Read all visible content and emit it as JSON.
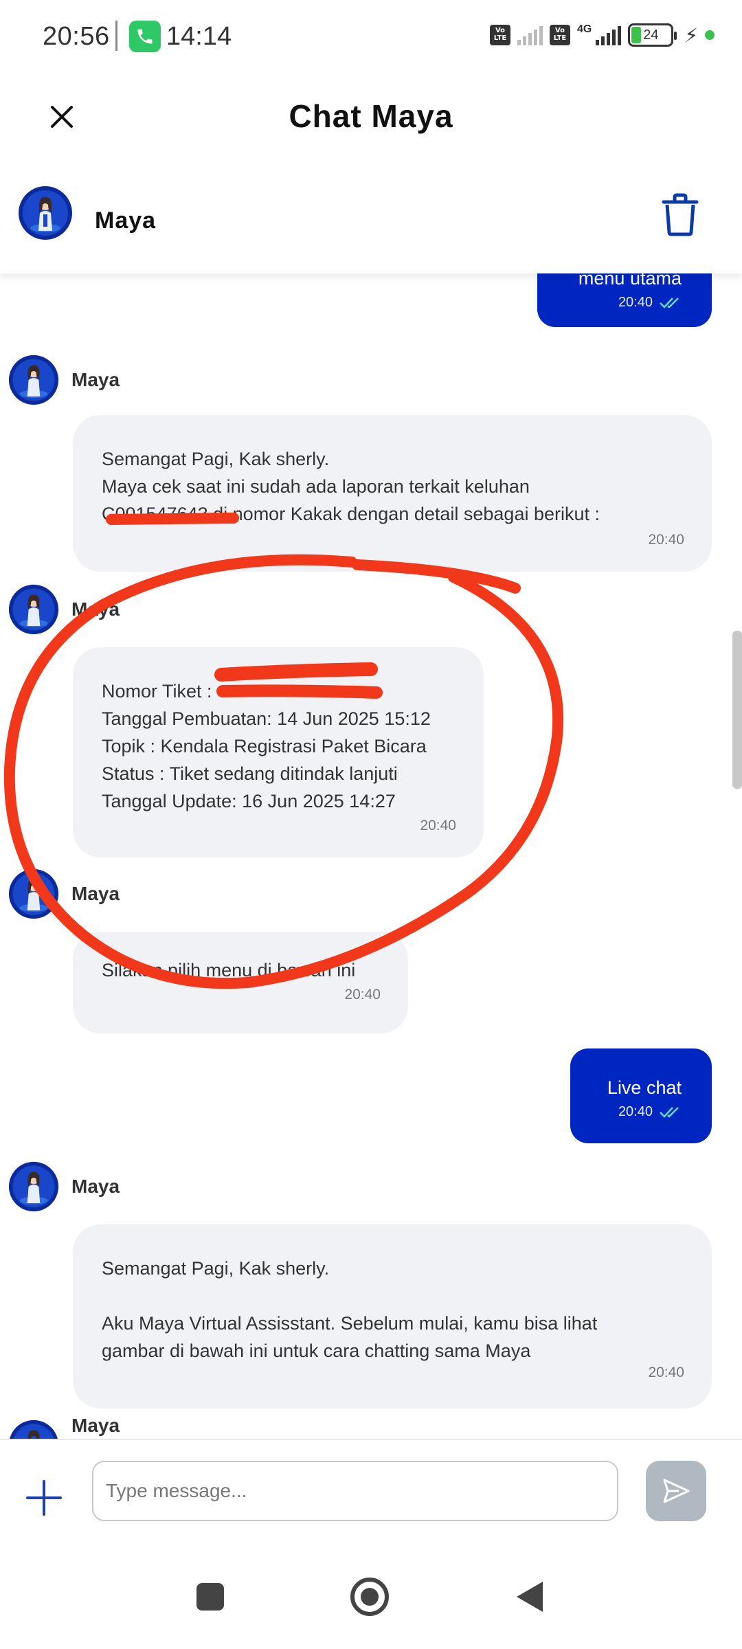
{
  "status_bar": {
    "time": "20:56",
    "call_time": "14:14",
    "battery_level": "24",
    "network": "4G",
    "volte_label": "Vo LTE"
  },
  "header": {
    "title": "Chat Maya",
    "agent_name": "Maya"
  },
  "messages": {
    "out_1": {
      "text": "menu utama",
      "time": "20:40"
    },
    "in_1": {
      "sender": "Maya",
      "lines": [
        "Semangat Pagi, Kak sherly.",
        "Maya cek saat ini sudah ada laporan terkait keluhan",
        "C001547643 di nomor Kakak dengan detail sebagai berikut :"
      ],
      "time": "20:40"
    },
    "in_2": {
      "sender": "Maya",
      "lines": [
        "Nomor Tiket : ",
        "Tanggal Pembuatan: 14 Jun 2025 15:12",
        "Topik : Kendala Registrasi Paket Bicara",
        "Status : Tiket sedang ditindak lanjuti",
        "Tanggal Update: 16 Jun 2025 14:27"
      ],
      "time": "20:40"
    },
    "in_3": {
      "sender": "Maya",
      "lines": [
        "Silakan pilih menu di bawah ini"
      ],
      "time": "20:40"
    },
    "out_2": {
      "text": "Live chat",
      "time": "20:40"
    },
    "in_4": {
      "sender": "Maya",
      "lines": [
        "Semangat Pagi, Kak sherly.",
        "Aku Maya Virtual Assisstant. Sebelum mulai, kamu bisa lihat",
        "gambar di bawah ini untuk cara chatting sama Maya"
      ],
      "time": "20:40"
    },
    "in_5": {
      "sender": "Maya"
    }
  },
  "composer": {
    "placeholder": "Type message..."
  },
  "icons": {
    "close": "close-icon",
    "trash": "trash-icon",
    "plus": "plus-icon",
    "send": "send-icon",
    "read_receipt": "double-check-icon"
  },
  "colors": {
    "brand_blue": "#0026c2",
    "incoming_bubble": "#f0f2f5",
    "annotation_red": "#f2381a",
    "send_disabled": "#b0b8c2"
  }
}
